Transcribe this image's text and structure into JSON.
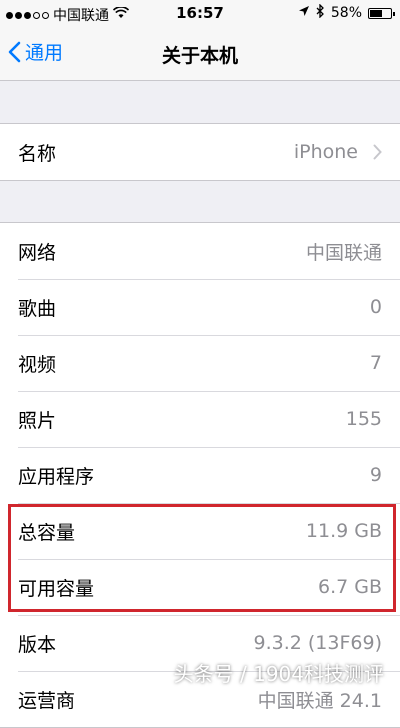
{
  "status_bar": {
    "carrier": "中国联通",
    "time": "16:57",
    "battery": "58%",
    "battery_level": 0.58,
    "icons": [
      "signal-icon",
      "wifi-icon",
      "location-icon",
      "bluetooth-icon",
      "battery-icon"
    ]
  },
  "nav": {
    "back_label": "通用",
    "title": "关于本机"
  },
  "group1": [
    {
      "label": "名称",
      "value": "iPhone",
      "chevron": true
    }
  ],
  "group2": [
    {
      "label": "网络",
      "value": "中国联通"
    },
    {
      "label": "歌曲",
      "value": "0"
    },
    {
      "label": "视频",
      "value": "7"
    },
    {
      "label": "照片",
      "value": "155"
    },
    {
      "label": "应用程序",
      "value": "9"
    },
    {
      "label": "总容量",
      "value": "11.9 GB"
    },
    {
      "label": "可用容量",
      "value": "6.7 GB"
    },
    {
      "label": "版本",
      "value": "9.3.2 (13F69)"
    },
    {
      "label": "运营商",
      "value": "中国联通 24.1"
    }
  ],
  "highlight_color": "#d0262d",
  "accent_color": "#007aff",
  "watermark": "头条号 / 1904科技测评"
}
